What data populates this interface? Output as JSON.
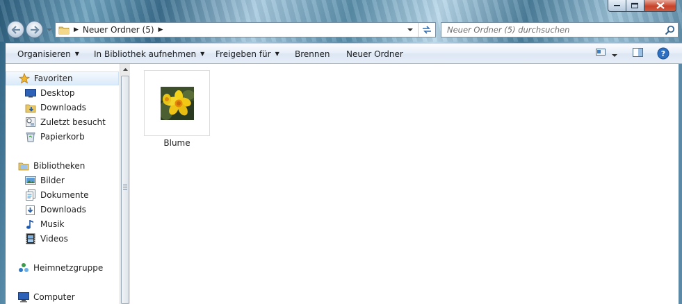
{
  "window": {
    "caption_buttons": [
      "minimize",
      "maximize",
      "close"
    ]
  },
  "address_bar": {
    "breadcrumb": "Neuer Ordner (5)"
  },
  "search": {
    "placeholder": "Neuer Ordner (5) durchsuchen"
  },
  "toolbar": {
    "organize": "Organisieren",
    "library": "In Bibliothek aufnehmen",
    "share": "Freigeben für",
    "burn": "Brennen",
    "new_folder": "Neuer Ordner"
  },
  "nav_pane": {
    "favorites": {
      "label": "Favoriten",
      "items": [
        {
          "label": "Desktop",
          "icon": "desktop-icon"
        },
        {
          "label": "Downloads",
          "icon": "downloads-icon"
        },
        {
          "label": "Zuletzt besucht",
          "icon": "recent-places-icon"
        },
        {
          "label": "Papierkorb",
          "icon": "recycle-bin-icon"
        }
      ]
    },
    "libraries": {
      "label": "Bibliotheken",
      "items": [
        {
          "label": "Bilder",
          "icon": "pictures-icon"
        },
        {
          "label": "Dokumente",
          "icon": "documents-icon"
        },
        {
          "label": "Downloads",
          "icon": "downloads-icon"
        },
        {
          "label": "Musik",
          "icon": "music-icon"
        },
        {
          "label": "Videos",
          "icon": "videos-icon"
        }
      ]
    },
    "homegroup": {
      "label": "Heimnetzgruppe"
    },
    "computer": {
      "label": "Computer"
    }
  },
  "content": {
    "files": [
      {
        "name": "Blume",
        "icon": "flower-image-thumbnail"
      }
    ]
  },
  "colors": {
    "accent": "#1e5b8c",
    "selected_bg": "#dbeaf9",
    "close_button": "#c7432b"
  }
}
